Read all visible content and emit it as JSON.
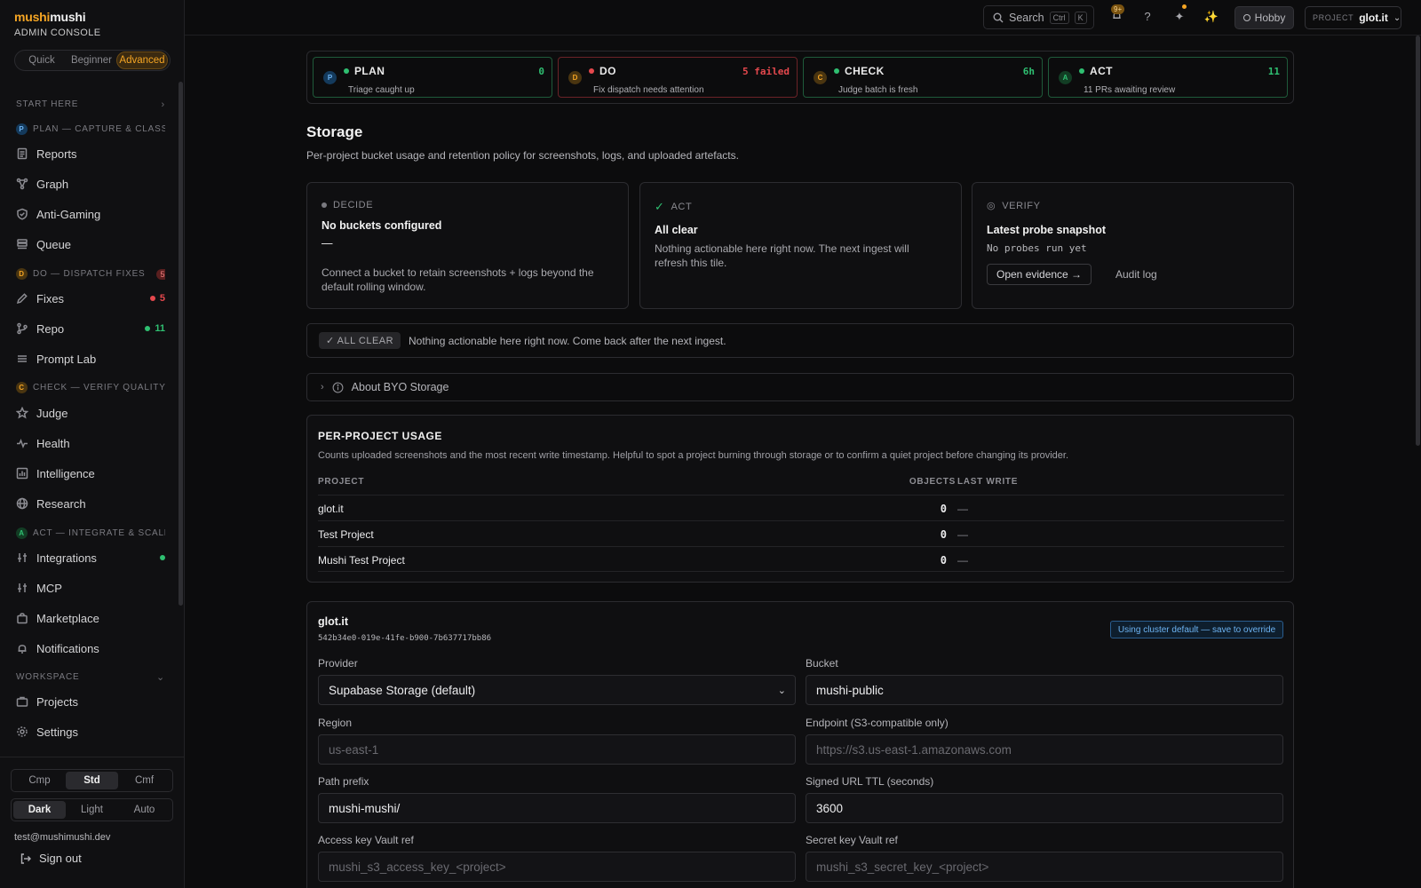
{
  "brand": {
    "part1": "mushi",
    "part2": "mushi",
    "subtitle": "ADMIN CONSOLE"
  },
  "mode": {
    "options": [
      "Quick",
      "Beginner",
      "Advanced"
    ],
    "active": "Advanced"
  },
  "sidebar": {
    "start_here": "START HERE",
    "sections": {
      "plan": {
        "letter": "P",
        "label": "PLAN — CAPTURE & CLASS..."
      },
      "do": {
        "letter": "D",
        "label": "DO — DISPATCH FIXES",
        "count": "5"
      },
      "check": {
        "letter": "C",
        "label": "CHECK — VERIFY QUALITY"
      },
      "act": {
        "letter": "A",
        "label": "ACT — INTEGRATE & SCALE"
      },
      "workspace": {
        "label": "WORKSPACE"
      }
    },
    "items": {
      "reports": "Reports",
      "graph": "Graph",
      "anti_gaming": "Anti-Gaming",
      "queue": "Queue",
      "fixes": "Fixes",
      "fixes_badge": "5",
      "repo": "Repo",
      "repo_badge": "11",
      "prompt_lab": "Prompt Lab",
      "judge": "Judge",
      "health": "Health",
      "intelligence": "Intelligence",
      "research": "Research",
      "integrations": "Integrations",
      "mcp": "MCP",
      "marketplace": "Marketplace",
      "notifications": "Notifications",
      "projects": "Projects",
      "settings": "Settings"
    },
    "density": {
      "options": [
        "Cmp",
        "Std",
        "Cmf"
      ],
      "active": "Std"
    },
    "theme": {
      "options": [
        "Dark",
        "Light",
        "Auto"
      ],
      "active": "Dark"
    },
    "user_email": "test@mushimushi.dev",
    "sign_out": "Sign out"
  },
  "topbar": {
    "search_label": "Search",
    "kbd1": "Ctrl",
    "kbd2": "K",
    "notif_count": "9+",
    "plan_label": "Hobby",
    "project_label": "PROJECT",
    "project_value": "glot.it"
  },
  "pdca": [
    {
      "letter": "P",
      "name": "PLAN",
      "sub": "Triage caught up",
      "right": "0",
      "status": "ok"
    },
    {
      "letter": "D",
      "name": "DO",
      "sub": "Fix dispatch needs attention",
      "right": "5 failed",
      "status": "bad"
    },
    {
      "letter": "C",
      "name": "CHECK",
      "sub": "Judge batch is fresh",
      "right": "6h",
      "status": "ok"
    },
    {
      "letter": "A",
      "name": "ACT",
      "sub": "11 PRs awaiting review",
      "right": "11",
      "status": "ok"
    }
  ],
  "page": {
    "title": "Storage",
    "description": "Per-project bucket usage and retention policy for screenshots, logs, and uploaded artefacts."
  },
  "tiles": {
    "decide": {
      "kind": "DECIDE",
      "heading": "No buckets configured",
      "dash": "—",
      "body": "Connect a bucket to retain screenshots + logs beyond the default rolling window."
    },
    "act": {
      "kind": "ACT",
      "heading": "All clear",
      "body": "Nothing actionable here right now. The next ingest will refresh this tile."
    },
    "verify": {
      "kind": "VERIFY",
      "heading": "Latest probe snapshot",
      "mono": "No probes run yet",
      "btn_evidence": "Open evidence →",
      "btn_audit": "Audit log"
    }
  },
  "all_clear": {
    "chip": "✓ ALL CLEAR",
    "text": "Nothing actionable here right now. Come back after the next ingest."
  },
  "about": {
    "label": "About BYO Storage"
  },
  "usage": {
    "title": "PER-PROJECT USAGE",
    "description": "Counts uploaded screenshots and the most recent write timestamp. Helpful to spot a project burning through storage or to confirm a quiet project before changing its provider.",
    "columns": [
      "PROJECT",
      "OBJECTS",
      "LAST WRITE"
    ],
    "rows": [
      {
        "project": "glot.it",
        "objects": "0",
        "last_write": "—"
      },
      {
        "project": "Test Project",
        "objects": "0",
        "last_write": "—"
      },
      {
        "project": "Mushi Test Project",
        "objects": "0",
        "last_write": "—"
      }
    ]
  },
  "config": {
    "project_name": "glot.it",
    "project_id": "542b34e0-019e-41fe-b900-7b637717bb86",
    "flag": "Using cluster default — save to override",
    "provider_label": "Provider",
    "provider_value": "Supabase Storage (default)",
    "bucket_label": "Bucket",
    "bucket_value": "mushi-public",
    "region_label": "Region",
    "region_placeholder": "us-east-1",
    "endpoint_label": "Endpoint (S3-compatible only)",
    "endpoint_placeholder": "https://s3.us-east-1.amazonaws.com",
    "prefix_label": "Path prefix",
    "prefix_value": "mushi-mushi/",
    "ttl_label": "Signed URL TTL (seconds)",
    "ttl_value": "3600",
    "access_label": "Access key Vault ref",
    "access_placeholder": "mushi_s3_access_key_<project>",
    "secret_label": "Secret key Vault ref",
    "secret_placeholder": "mushi_s3_secret_key_<project>"
  },
  "colors": {
    "accent": "#f5a524",
    "ok": "#2fbf71",
    "bad": "#e5484d",
    "info": "#6db3f2"
  }
}
